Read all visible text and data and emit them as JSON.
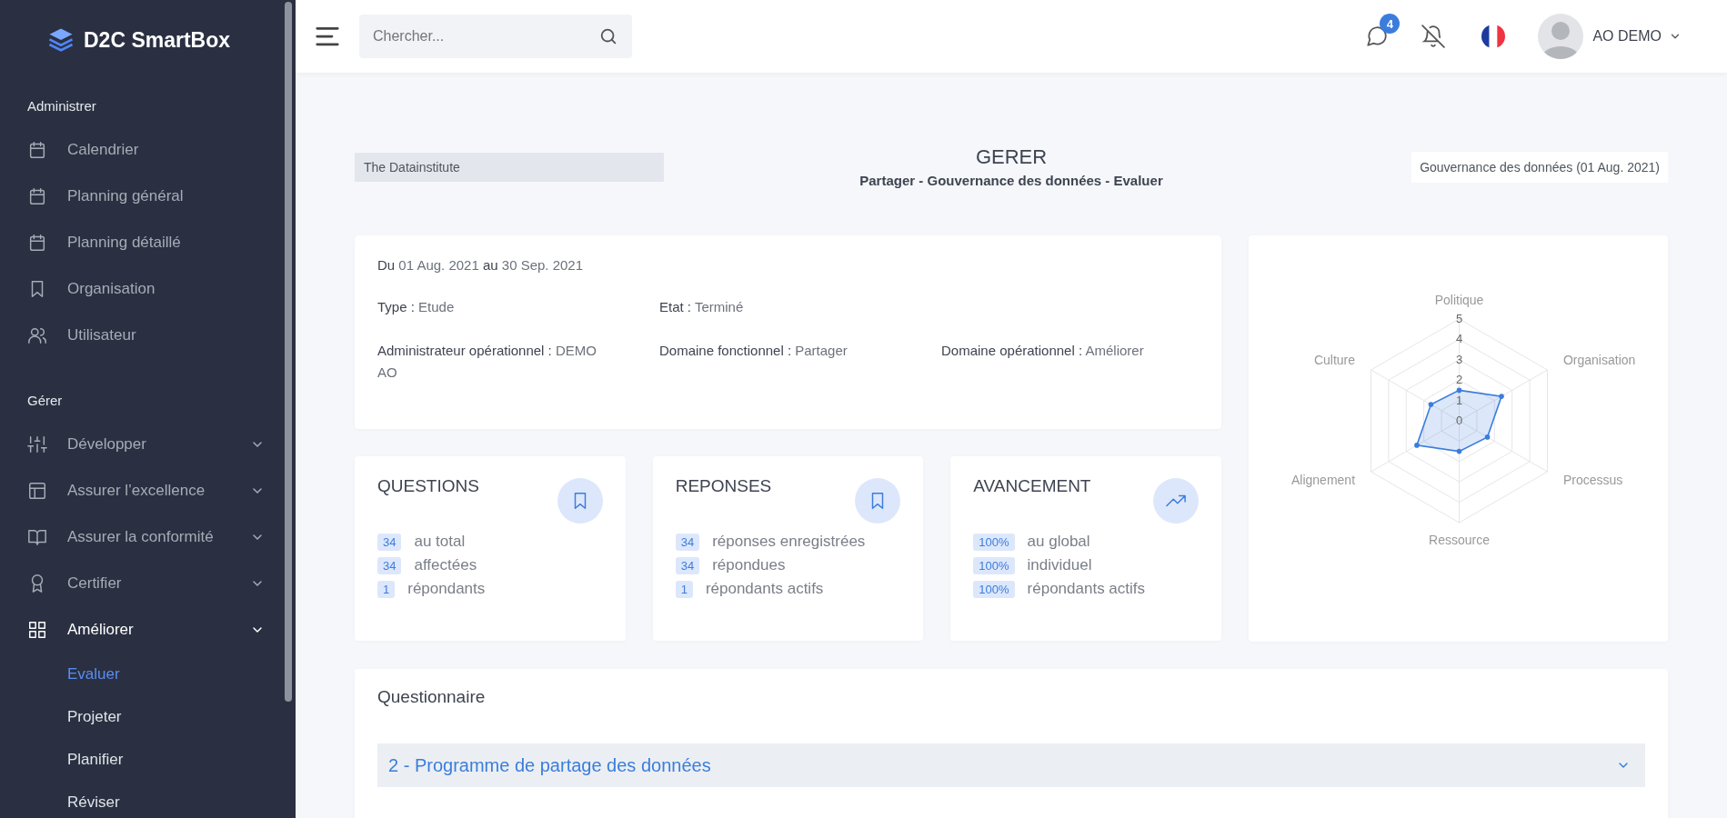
{
  "sidebar": {
    "logo": "D2C SmartBox",
    "sections": [
      {
        "title": "Administrer",
        "items": [
          {
            "label": "Calendrier",
            "kind": "link"
          },
          {
            "label": "Planning général",
            "kind": "link"
          },
          {
            "label": "Planning détaillé",
            "kind": "link"
          },
          {
            "label": "Organisation",
            "kind": "link"
          },
          {
            "label": "Utilisateur",
            "kind": "link"
          }
        ]
      },
      {
        "title": "Gérer",
        "items": [
          {
            "label": "Développer",
            "kind": "group",
            "expanded": false
          },
          {
            "label": "Assurer l’excellence",
            "kind": "group",
            "expanded": false
          },
          {
            "label": "Assurer la conformité",
            "kind": "group",
            "expanded": false
          },
          {
            "label": "Certifier",
            "kind": "group",
            "expanded": false
          },
          {
            "label": "Améliorer",
            "kind": "group",
            "expanded": true,
            "children": [
              {
                "label": "Evaluer",
                "selected": true
              },
              {
                "label": "Projeter",
                "selected": false
              },
              {
                "label": "Planifier",
                "selected": false
              },
              {
                "label": "Réviser",
                "selected": false
              }
            ]
          }
        ]
      }
    ]
  },
  "topbar": {
    "search": {
      "placeholder": "Chercher..."
    },
    "messages_badge": "4",
    "user": "AO DEMO"
  },
  "header": {
    "organization": "The Datainstitute",
    "title": "GERER",
    "subtitle": "Partager - Gouvernance des données - Evaluer",
    "assessment": "Gouvernance des données (01 Aug. 2021)"
  },
  "info": {
    "period": "**Du** 01 Aug. 2021 **au** 30 Sep. 2021",
    "rows": [
      [
        {
          "label": "Type :",
          "value": "Etude"
        },
        {
          "label": "Etat :",
          "value": "Terminé"
        }
      ],
      [
        {
          "label": "Administrateur opérationnel :",
          "value": "DEMO AO"
        },
        {
          "label": "Domaine fonctionnel :",
          "value": "Partager"
        },
        {
          "label": "Domaine opérationnel :",
          "value": "Améliorer"
        }
      ]
    ]
  },
  "stats": [
    {
      "title": "QUESTIONS",
      "rows": [
        {
          "badge": "34",
          "label": "au total"
        },
        {
          "badge": "34",
          "label": "affectées"
        },
        {
          "badge": "1",
          "label": "répondants"
        }
      ]
    },
    {
      "title": "REPONSES",
      "rows": [
        {
          "badge": "34",
          "label": "réponses enregistrées"
        },
        {
          "badge": "34",
          "label": "répondues"
        },
        {
          "badge": "1",
          "label": "répondants actifs"
        }
      ]
    },
    {
      "title": "AVANCEMENT",
      "rows": [
        {
          "badge": "100%",
          "label": "au global"
        },
        {
          "badge": "100%",
          "label": "individuel"
        },
        {
          "badge": "100%",
          "label": "répondants actifs"
        }
      ]
    }
  ],
  "radar": {
    "chart_data": {
      "type": "radar",
      "categories": [
        "Politique",
        "Organisation",
        "Processus",
        "Ressource",
        "Alignement",
        "Culture"
      ],
      "ylim": [
        0,
        5
      ],
      "yticks": [
        0,
        1,
        2,
        3,
        4,
        5
      ],
      "series": [
        {
          "color": "#3b7ddd",
          "values": [
            1.5,
            2.4,
            1.6,
            1.5,
            2.4,
            1.6
          ]
        }
      ]
    }
  },
  "questionnaire": {
    "title": "Questionnaire",
    "sections": [
      {
        "label": "2 - Programme de partage des données",
        "expanded": false
      }
    ]
  }
}
